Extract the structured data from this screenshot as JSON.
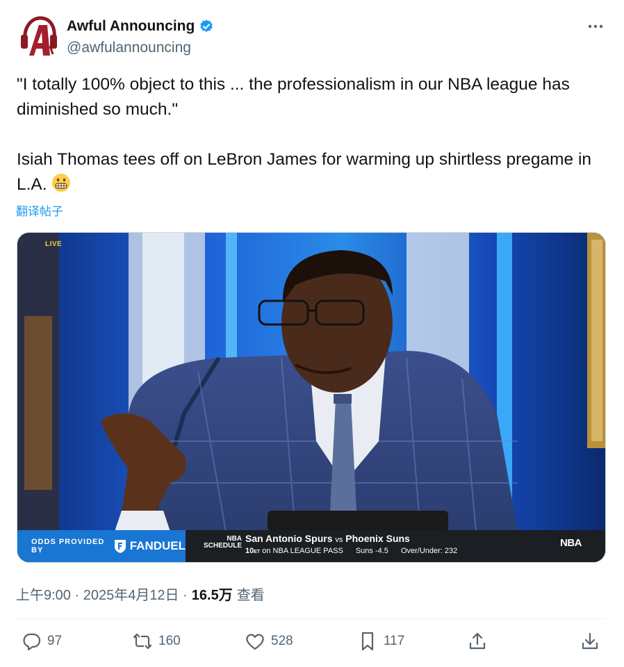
{
  "author": {
    "display_name": "Awful Announcing",
    "handle": "@awfulannouncing",
    "avatar_letters": "A"
  },
  "tweet": {
    "line1": "\"I totally 100% object to this ... the professionalism in our NBA league has diminished so much.\"",
    "line2": "Isiah Thomas tees off on LeBron James for warming up shirtless pregame in L.A.",
    "emoji": "grimacing-face",
    "translate_label": "翻译帖子"
  },
  "media": {
    "live_badge": "LIVE",
    "odds_label": "ODDS PROVIDED BY",
    "sponsor": "FANDUEL",
    "schedule_label_1": "NBA",
    "schedule_label_2": "SCHEDULE",
    "team_home": "San Antonio Spurs",
    "vs": "vs",
    "team_away": "Phoenix Suns",
    "time": "10",
    "time_suffix": "ET",
    "channel": "on NBA LEAGUE PASS",
    "spread": "Suns -4.5",
    "over_under": "Over/Under: 232",
    "network_logo": "NBA"
  },
  "meta": {
    "timestamp": "上午9:00 · 2025年4月12日 ·",
    "views": "16.5万",
    "views_label": "查看"
  },
  "actions": {
    "replies": "97",
    "reposts": "160",
    "likes": "528",
    "bookmarks": "117"
  },
  "colors": {
    "accent": "#1d9bf0",
    "verified": "#1d9bf0",
    "fanduel": "#1976d2"
  }
}
